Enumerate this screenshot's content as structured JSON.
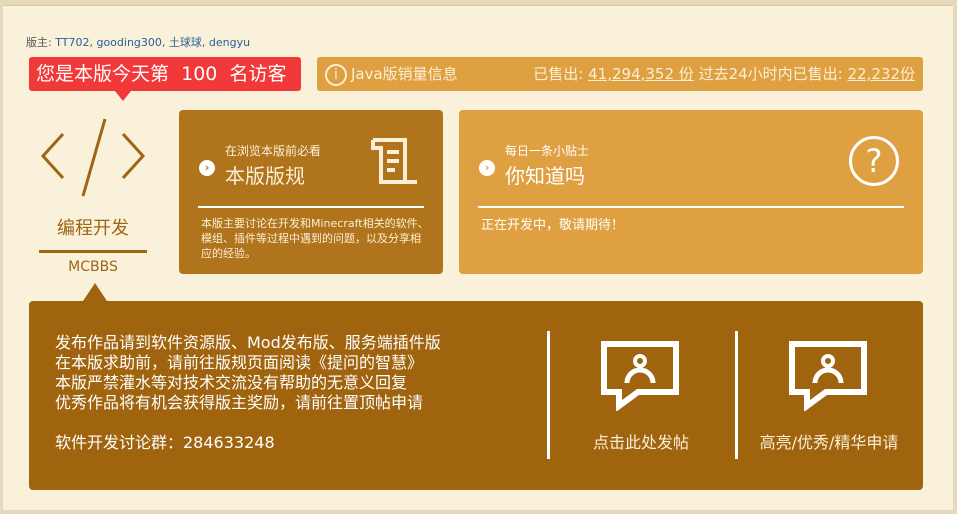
{
  "moderators": {
    "label": "版主:",
    "names": [
      "TT702",
      "gooding300",
      "土球球",
      "dengyu"
    ]
  },
  "visitor": {
    "prefix": "您是本版今天第",
    "count": "100",
    "suffix": "名访客"
  },
  "sales": {
    "title": "Java版销量信息",
    "sold_label": "已售出:",
    "sold_value": "41,294,352 份",
    "recent_label": "过去24小时内已售出:",
    "recent_value": "22,232份"
  },
  "logo": {
    "title": "编程开发",
    "subtitle": "MCBBS"
  },
  "rules_card": {
    "kicker": "在浏览本版前必看",
    "title": "本版版规",
    "desc": "本版主要讨论在开发和Minecraft相关的软件、模组、插件等过程中遇到的问题，以及分享相应的经验。"
  },
  "tips_card": {
    "kicker": "每日一条小贴士",
    "title": "你知道吗",
    "desc": "正在开发中，敬请期待！"
  },
  "notice": {
    "lines": [
      "发布作品请到软件资源版、Mod发布版、服务端插件版",
      "在本版求助前，请前往版规页面阅读《提问的智慧》",
      "本版严禁灌水等对技术交流没有帮助的无意义回复",
      "优秀作品将有机会获得版主奖励，请前往置顶帖申请"
    ],
    "group": "软件开发讨论群：284633248"
  },
  "actions": {
    "post": "点击此处发帖",
    "apply": "高亮/优秀/精华申请"
  },
  "colors": {
    "brown": "#b0741c",
    "gold": "#dea040",
    "dark_brown": "#a0640f",
    "red": "#f2393a"
  }
}
